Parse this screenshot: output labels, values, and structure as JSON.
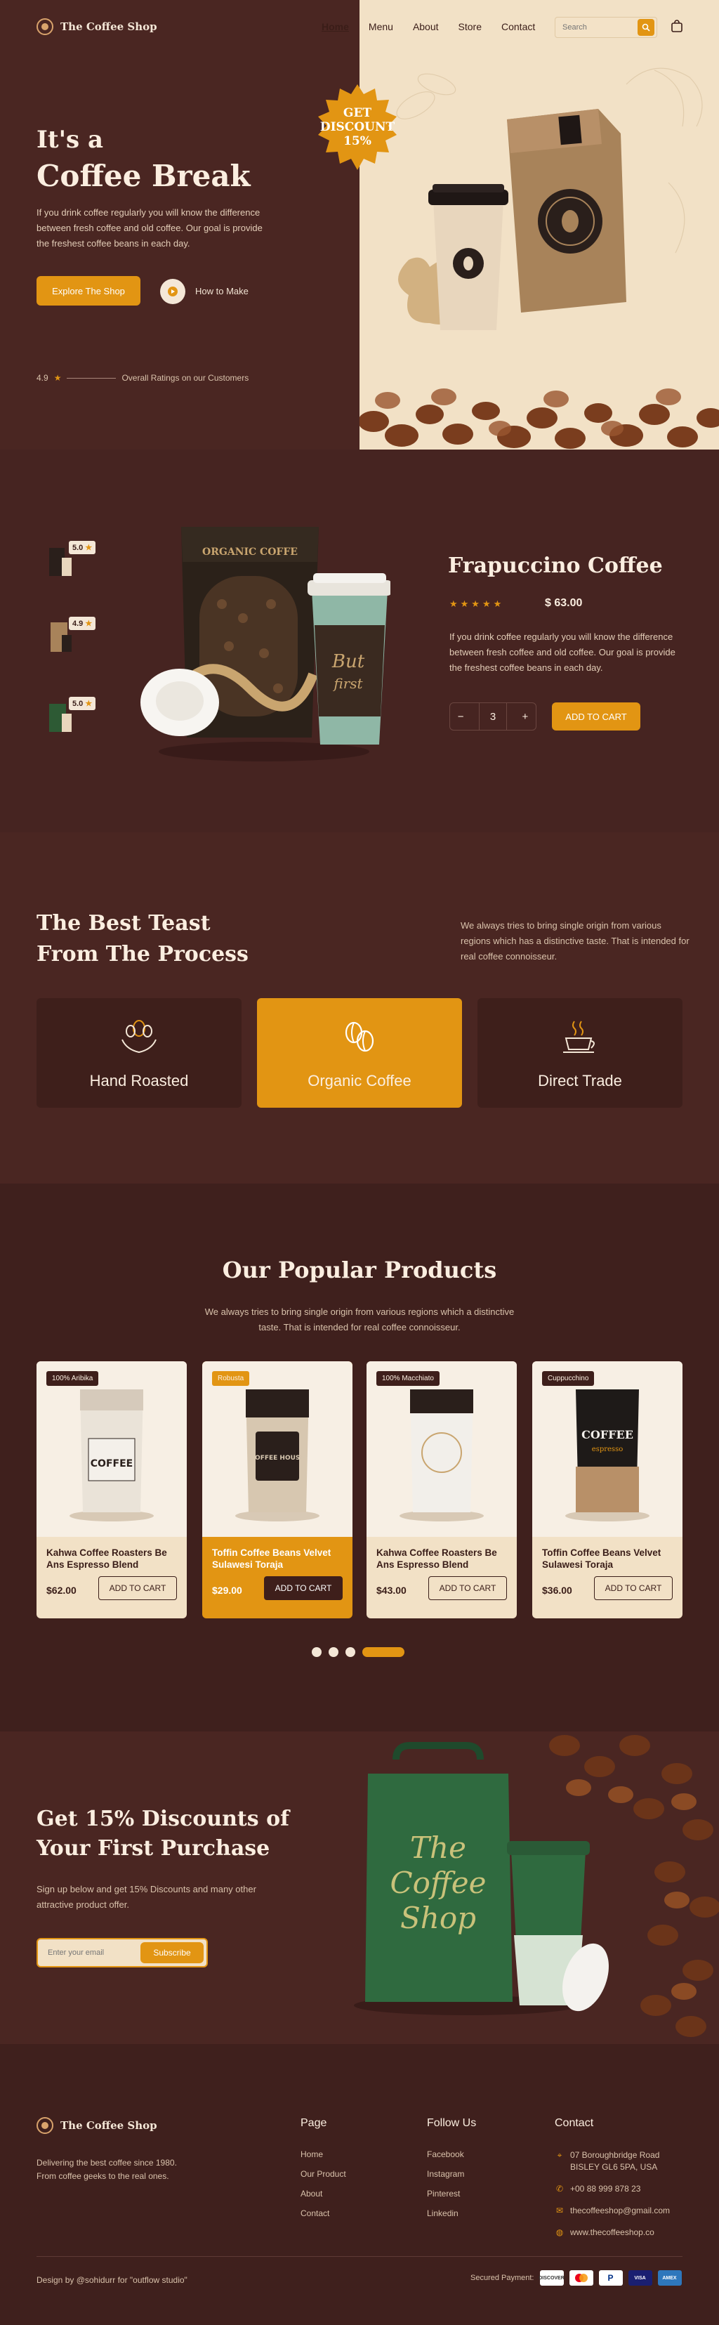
{
  "brand": {
    "name": "The Coffee Shop"
  },
  "nav": {
    "items": [
      {
        "label": "Home"
      },
      {
        "label": "Menu"
      },
      {
        "label": "About"
      },
      {
        "label": "Store"
      },
      {
        "label": "Contact"
      }
    ],
    "search_placeholder": "Search"
  },
  "hero": {
    "title_line1": "It's a",
    "title_line2": "Coffee Break",
    "description": "If you drink coffee regularly you will know the difference between fresh coffee and old coffee. Our goal is provide the freshest coffee beans in each day.",
    "cta_label": "Explore The Shop",
    "secondary_label": "How to Make",
    "rating_value": "4.9",
    "rating_text": "Overall Ratings on our Customers",
    "badge_line1": "GET",
    "badge_line2": "DISCOUNT",
    "badge_line3": "15%"
  },
  "featured": {
    "thumbs": [
      {
        "rating": "5.0"
      },
      {
        "rating": "4.9"
      },
      {
        "rating": "5.0"
      }
    ],
    "title": "Frapuccino Coffee",
    "stars": "★★★★★",
    "price": "$ 63.00",
    "description": "If you drink coffee regularly you will know the difference between fresh coffee and old coffee. Our goal is provide the freshest coffee beans in each day.",
    "quantity": "3",
    "minus": "−",
    "plus": "+",
    "cart_label": "ADD TO CART"
  },
  "process": {
    "title_line1": "The Best Teast",
    "title_line2": "From The Process",
    "description": "We always tries to bring single origin from various regions which has a distinctive taste. That is intended for real coffee connoisseur.",
    "cards": [
      {
        "label": "Hand Roasted"
      },
      {
        "label": "Organic Coffee"
      },
      {
        "label": "Direct Trade"
      }
    ]
  },
  "popular": {
    "title": "Our Popular Products",
    "description": "We always tries to bring single origin from various regions which a distinctive taste. That is intended for real coffee connoisseur.",
    "products": [
      {
        "tag": "100% Aribika",
        "name": "Kahwa Coffee Roasters Be Ans Espresso Blend",
        "price": "$62.00",
        "cart": "ADD TO CART"
      },
      {
        "tag": "Robusta",
        "name": "Toffin Coffee Beans Velvet Sulawesi Toraja",
        "price": "$29.00",
        "cart": "ADD TO CART"
      },
      {
        "tag": "100% Macchiato",
        "name": "Kahwa Coffee Roasters Be Ans Espresso Blend",
        "price": "$43.00",
        "cart": "ADD TO CART"
      },
      {
        "tag": "Cuppucchino",
        "name": "Toffin Coffee Beans Velvet Sulawesi Toraja",
        "price": "$36.00",
        "cart": "ADD TO CART"
      }
    ]
  },
  "discount": {
    "title_line1": "Get 15% Discounts of",
    "title_line2": "Your First Purchase",
    "description": "Sign up below and get 15% Discounts and many other attractive product offer.",
    "email_placeholder": "Enter your email",
    "button": "Subscribe"
  },
  "footer": {
    "description": "Delivering the best coffee since 1980. From coffee geeks to the real ones.",
    "page_title": "Page",
    "page_links": [
      {
        "label": "Home"
      },
      {
        "label": "Our Product"
      },
      {
        "label": "About"
      },
      {
        "label": "Contact"
      }
    ],
    "follow_title": "Follow Us",
    "follow_links": [
      {
        "label": "Facebook"
      },
      {
        "label": "Instagram"
      },
      {
        "label": "Pinterest"
      },
      {
        "label": "Linkedin"
      }
    ],
    "contact_title": "Contact",
    "address": "07 Boroughbridge Road BISLEY GL6 5PA, USA",
    "phone": "+00 88 999 878 23",
    "email": "thecoffeeshop@gmail.com",
    "website": "www.thecoffeeshop.co",
    "credit": "Design by @sohidurr for \"outflow studio\"",
    "payment_label": "Secured Payment:",
    "payments": [
      {
        "label": "DISCOVER"
      },
      {
        "label": "MC"
      },
      {
        "label": "P"
      },
      {
        "label": "VISA"
      },
      {
        "label": "AMEX"
      }
    ]
  },
  "colors": {
    "accent": "#e29513",
    "dark": "#4a2622",
    "cream": "#f2e1c6"
  }
}
